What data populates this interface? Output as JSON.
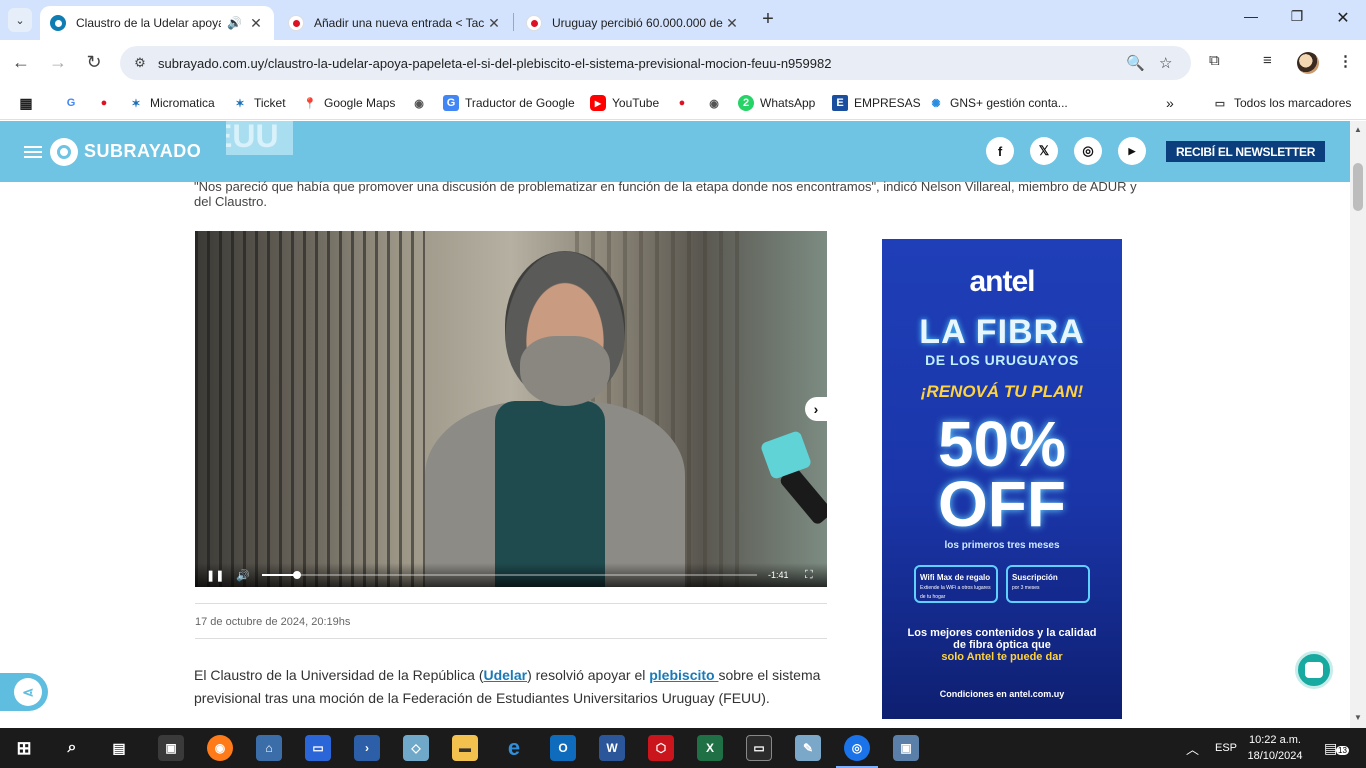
{
  "browser": {
    "tabs": [
      {
        "title": "Claustro de la Udelar apoya",
        "active": true,
        "audio": true
      },
      {
        "title": "Añadir una nueva entrada < Tac",
        "active": false
      },
      {
        "title": "Uruguay percibió 60.000.000 de",
        "active": false
      }
    ],
    "url": "subrayado.com.uy/claustro-la-udelar-apoya-papeleta-el-si-del-plebiscito-el-sistema-previsional-mocion-feuu-n959982",
    "bookmarks": [
      {
        "label": "",
        "icon": "google-icon"
      },
      {
        "label": "",
        "icon": "red-dot-icon"
      },
      {
        "label": "Micromatica",
        "icon": "micromatica-icon"
      },
      {
        "label": "Ticket",
        "icon": "ticket-icon"
      },
      {
        "label": "Google Maps",
        "icon": "maps-pin-icon"
      },
      {
        "label": "",
        "icon": "globe-icon"
      },
      {
        "label": "Traductor de Google",
        "icon": "translate-icon"
      },
      {
        "label": "YouTube",
        "icon": "youtube-icon"
      },
      {
        "label": "",
        "icon": "red-dot-icon"
      },
      {
        "label": "",
        "icon": "globe-icon"
      },
      {
        "label": "WhatsApp",
        "icon": "whatsapp-icon"
      },
      {
        "label": "EMPRESAS",
        "icon": "empresas-icon"
      },
      {
        "label": "GNS+ gestión conta...",
        "icon": "gns-icon"
      }
    ],
    "all_bookmarks": "Todos los marcadores"
  },
  "site": {
    "logo": "SUBRAYADO",
    "header_bg_text": "EUU",
    "newsletter": "RECIBÍ EL NEWSLETTER",
    "social": [
      "facebook-icon",
      "x-icon",
      "instagram-icon",
      "youtube-icon"
    ]
  },
  "article": {
    "quote": "\"Nos pareció que había que promover una discusión de problematizar en función de la etapa donde nos encontramos\", indicó Nelson Villareal, miembro de ADUR y del Claustro.",
    "video": {
      "time_remaining": "-1:41",
      "progress": 0.07
    },
    "date": "17 de octubre de 2024, 20:19hs",
    "body": {
      "p1": "El Claustro de la Universidad de la República (",
      "link1": "Udelar",
      "p2": ") resolvió apoyar el ",
      "link2": "plebiscito ",
      "p3": "sobre el sistema previsional tras una moción de la Federación de Estudiantes Universitarios Uruguay (FEUU)."
    }
  },
  "ad": {
    "brand": "antel",
    "headline1": "LA FIBRA",
    "headline2": "DE LOS URUGUAYOS",
    "headline3": "¡RENOVÁ TU PLAN!",
    "big_line1": "50%",
    "big_line2": "OFF",
    "sub": "los primeros tres meses",
    "box1_title": "Wifi Max de regalo",
    "box1_sub": "Extiende la WiFi a otros lugares de tu hogar",
    "box2_title": "Suscripción",
    "box2_sub": "por 3 meses",
    "text_line1": "Los mejores contenidos y la calidad de fibra óptica que",
    "text_line2": "solo Antel te puede dar",
    "footer": "Condiciones en antel.com.uy"
  },
  "taskbar": {
    "language": "ESP",
    "time": "10:22 a.m.",
    "date": "18/10/2024",
    "notifications": "13"
  }
}
